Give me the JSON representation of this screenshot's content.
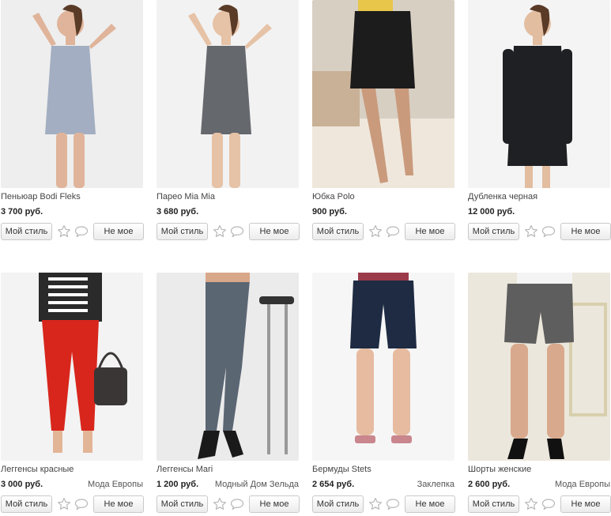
{
  "buttons": {
    "my_style": "Мой стиль",
    "not_mine": "Не мое"
  },
  "products": [
    {
      "name": "Пеньюар Bodi Fleks",
      "price": "3 700 руб.",
      "shop": "",
      "image": "woman-in-lace-negligee",
      "bg": "#eeeeee",
      "garment": "#9aa6bd",
      "skin": "#e0b49a"
    },
    {
      "name": "Парео Mia Mia",
      "price": "3 680 руб.",
      "shop": "",
      "image": "woman-in-printed-pareo",
      "bg": "#f2f2f2",
      "garment": "#55595e",
      "skin": "#e6c2a6"
    },
    {
      "name": "Юбка Polo",
      "price": "900 руб.",
      "shop": "",
      "image": "black-skirt-on-legs",
      "bg": "#d8cfc3",
      "garment": "#1c1c1c",
      "skin": "#c99a7c"
    },
    {
      "name": "Дубленка черная",
      "price": "12 000 руб.",
      "shop": "",
      "image": "woman-in-black-coat",
      "bg": "#f4f4f4",
      "garment": "#1f2023",
      "skin": "#e2bda0"
    },
    {
      "name": "Леггенсы красные",
      "price": "3 000 руб.",
      "shop": "Мода Европы",
      "image": "red-leather-leggings",
      "bg": "#f3f3f3",
      "garment": "#d8261c",
      "skin": "#e3b597"
    },
    {
      "name": "Леггенсы Mari",
      "price": "1 200 руб.",
      "shop": "Модный Дом Зельда",
      "image": "velvet-leggings-with-bar-stool",
      "bg": "#ebebeb",
      "garment": "#5b6673",
      "skin": "#d9a78a"
    },
    {
      "name": "Бермуды Stets",
      "price": "2 654 руб.",
      "shop": "Заклепка",
      "image": "denim-bermuda-shorts",
      "bg": "#f6f6f6",
      "garment": "#1e2b42",
      "skin": "#e6bba0"
    },
    {
      "name": "Шорты женские",
      "price": "2 600 руб.",
      "shop": "Мода Европы",
      "image": "grey-tweed-shorts",
      "bg": "#ece7dc",
      "garment": "#5e5e5e",
      "skin": "#d9a98d"
    }
  ]
}
